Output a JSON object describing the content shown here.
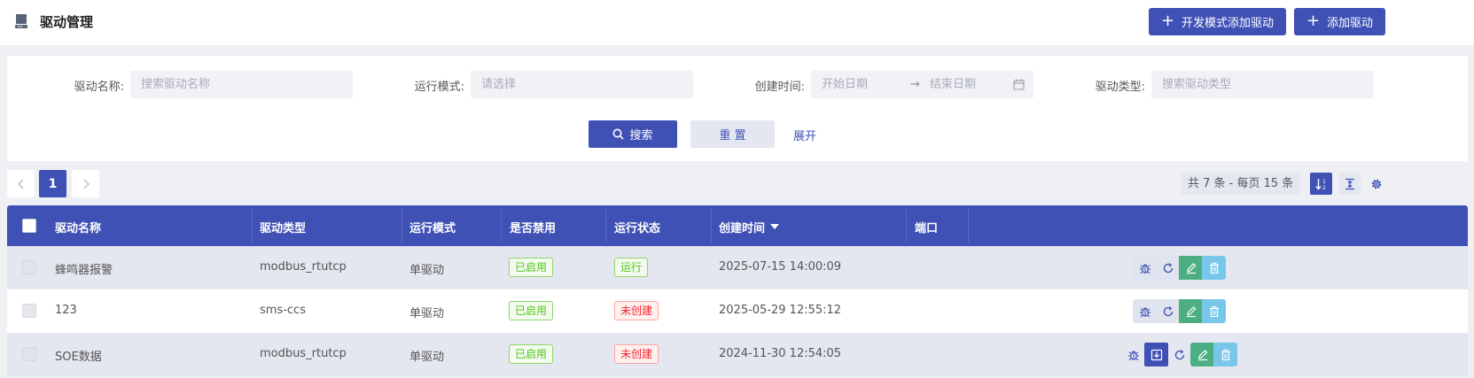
{
  "header": {
    "title": "驱动管理",
    "dev_mode_add_label": "开发模式添加驱动",
    "add_label": "添加驱动"
  },
  "filter": {
    "name_label": "驱动名称:",
    "name_placeholder": "搜索驱动名称",
    "mode_label": "运行模式:",
    "mode_placeholder": "请选择",
    "created_label": "创建时间:",
    "start_placeholder": "开始日期",
    "end_placeholder": "结束日期",
    "type_label": "驱动类型:",
    "type_placeholder": "搜索驱动类型",
    "search_label": "搜索",
    "reset_label": "重 置",
    "expand_label": "展开"
  },
  "pager": {
    "current_page": "1",
    "info": "共 7 条 - 每页 15 条"
  },
  "table": {
    "columns": [
      "驱动名称",
      "驱动类型",
      "运行模式",
      "是否禁用",
      "运行状态",
      "创建时间",
      "端口"
    ],
    "rows": [
      {
        "name": "蜂鸣器报警",
        "type": "modbus_rtutcp",
        "mode": "单驱动",
        "disabled": "已启用",
        "status": "运行",
        "created": "2025-07-15 14:00:09",
        "port": ""
      },
      {
        "name": "123",
        "type": "sms-ccs",
        "mode": "单驱动",
        "disabled": "已启用",
        "status": "未创建",
        "created": "2025-05-29 12:55:12",
        "port": ""
      },
      {
        "name": "SOE数据",
        "type": "modbus_rtutcp",
        "mode": "单驱动",
        "disabled": "已启用",
        "status": "未创建",
        "created": "2024-11-30 12:54:05",
        "port": ""
      }
    ]
  },
  "colors": {
    "primary": "#3f51b5",
    "enabled_green": "#52c41a",
    "not_created_red": "#f5222d",
    "edit_green": "#4caf84",
    "delete_blue": "#78c7ea"
  }
}
